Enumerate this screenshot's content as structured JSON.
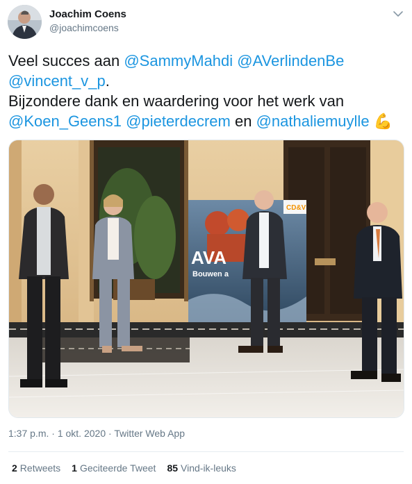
{
  "author": {
    "name": "Joachim Coens",
    "handle": "@joachimcoens"
  },
  "tweet": {
    "line1_text": "Veel succes aan ",
    "mention1": "@SammyMahdi",
    "mention2": "@AVerlindenBe",
    "mention3": "@vincent_v_p",
    "line2_period": ".",
    "line3_text": "Bijzondere dank en waardering voor het werk van",
    "mention4": "@Koen_Geens1",
    "mention5": "@pieterdecrem",
    "word_en": " en ",
    "mention6": "@nathaliemuylle",
    "emoji": "💪"
  },
  "photo": {
    "banner_text_1": "AVA",
    "banner_text_2": "Bouwen a",
    "banner_logo": "CD&V"
  },
  "meta": {
    "time": "1:37 p.m.",
    "sep1": " · ",
    "date": "1 okt. 2020",
    "sep2": " · ",
    "source": "Twitter Web App"
  },
  "stats": {
    "retweets_count": "2",
    "retweets_label": "Retweets",
    "quotes_count": "1",
    "quotes_label": "Geciteerde Tweet",
    "likes_count": "85",
    "likes_label": "Vind-ik-leuks"
  },
  "icons": {
    "caret": "chevron-down-icon"
  },
  "colors": {
    "link": "#1b95e0",
    "text": "#14171a",
    "muted": "#657786"
  }
}
